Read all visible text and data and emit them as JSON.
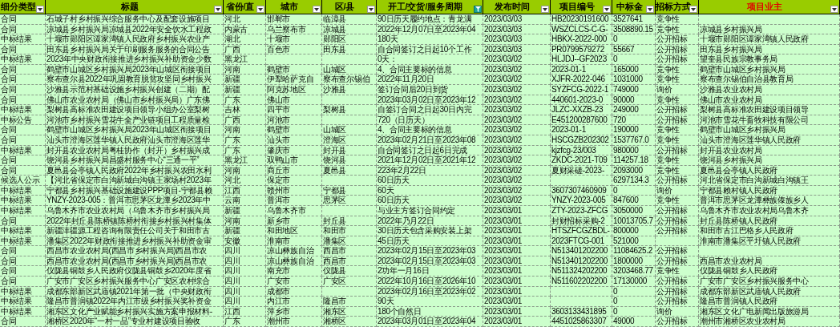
{
  "table": {
    "columns": [
      {
        "label": "细分类型",
        "filtered": false,
        "highlighted": false
      },
      {
        "label": "标题",
        "filtered": false,
        "highlighted": false
      },
      {
        "label": "省份/直",
        "filtered": false,
        "highlighted": false
      },
      {
        "label": "城市",
        "filtered": false,
        "highlighted": false
      },
      {
        "label": "区/县",
        "filtered": false,
        "highlighted": false
      },
      {
        "label": "开工/交货/服务周期",
        "filtered": true,
        "highlighted": false
      },
      {
        "label": "发布时间",
        "filtered": false,
        "highlighted": false
      },
      {
        "label": "项目编号",
        "filtered": false,
        "highlighted": false
      },
      {
        "label": "中标金",
        "filtered": false,
        "highlighted": false
      },
      {
        "label": "招标方式",
        "filtered": false,
        "highlighted": false
      },
      {
        "label": "项目业主",
        "filtered": false,
        "highlighted": true
      }
    ],
    "rows": [
      [
        "合同",
        "石城子村乡村振兴综合服务中心及配套设施项目",
        "河北",
        "邯郸市",
        "临漳县",
        "90日历天履约地点：青龙满",
        "2023/03/03",
        "HB20230191600",
        "3527641",
        "竞争性",
        null
      ],
      [
        "合同",
        "凉城县乡村振兴局凉城县2022年安全饮水工程政",
        "内蒙古",
        "乌兰察布市",
        "凉城县",
        "2022年12月07日至2023年04",
        "2023/03/03",
        "WSZCLCS-C-G-",
        "3508890.15",
        "竞争性",
        "凉城县乡村振兴局"
      ],
      [
        "中标结果",
        "十堰市郧阳区谭家湾镇人民政府乡村振兴农业产",
        "湖北",
        "十堰市",
        "郧阳区",
        "180天",
        "2023/03/03",
        "HBKX-2022-000",
        "0",
        "公开招标",
        "十堰市郧阳区谭家湾镇人民政府"
      ],
      [
        "合同",
        "田东县乡村振兴局关于印刷服务服务的合同公告",
        "广西",
        "百色市",
        "田东县",
        "自合同签订之日起10个工作",
        "2023/03/03",
        "PR0799579272",
        "55667",
        "公开招标",
        "田东县乡村振兴局"
      ],
      [
        "中标结果",
        "2023年中央财政衔接推进乡村振兴补助资金少数",
        "黑龙江",
        null,
        null,
        "0天：",
        "2023/03/02",
        "HLJDJ--GF2023",
        "0",
        "公开招标",
        "望奎县民族宗教事务局"
      ],
      [
        "合同",
        "鹤壁市山城区乡村振兴局2023年山城区衔接项目",
        "河南",
        "鹤壁市",
        "山城区",
        "4、合同主要标的信息",
        "2023/03/02",
        "2023-01-1",
        "165000",
        "竞争性",
        "鹤壁市山城区乡村振兴局"
      ],
      [
        "合同",
        "察布查尔县2022年巩固教育脱贫攻坚同乡村振兴",
        "新疆",
        "伊犁哈萨克自",
        "察布查尔锡伯",
        "2022年11月20日",
        "2023/03/02",
        "XJFR-2022-046",
        "1031000",
        "竞争性",
        "察布查尔锡伯自治县教育局"
      ],
      [
        "合同",
        "沙雅县示范村基础设施乡村振兴创建（二期）配",
        "新疆",
        "阿克苏地区",
        "沙雅县",
        "签订合同后20日到货",
        "2023/03/02",
        "SYZFCG-2022-1",
        "749000",
        "询价",
        "沙雅县农业农村局"
      ],
      [
        "合同",
        "佛山市农业农村局（佛山市乡村振兴局）广东佛",
        "广东",
        "佛山市",
        null,
        "2023年03月02日至2023年12",
        "2023/03/02",
        "440601-2023-0",
        "90000",
        "竞争性",
        "佛山市农业农村局"
      ],
      [
        "中标结果",
        "梨树县高标准农田建设项目领导小组办公室梨树",
        "吉林",
        "四平市",
        "梨树县",
        "自签订合同之日起30日内完",
        "2023/03/02",
        "JLZC-XXZB-23",
        "249000",
        "公开招标",
        "梨树县高标准农田建设项目领导"
      ],
      [
        "中标公告",
        "河池市乡村振兴雪花牛全产业链项目工程质量检",
        "广西",
        "河池市",
        null,
        "720（日历天）",
        "2023/03/02",
        "E451200287600",
        "720",
        "公开招标",
        "河池市雪花牛畜牧科技有限公司"
      ],
      [
        "合同",
        "鹤壁市山城区乡村振兴局2023年山城区衔接项目",
        "河南",
        "鹤壁市",
        "山城区",
        "4、合同主要标的信息",
        "2023/03/02",
        "2023-01-1",
        "190000",
        "竞争性",
        "鹤壁市山城区乡村振兴局"
      ],
      [
        "合同",
        "汕头市澄海区莲华镇人民政府汕头市澄海区莲华",
        "广东",
        "汕头市",
        "澄海区",
        "2023年02月21日至2023年08",
        "2023/03/02",
        "HSCGZB202302",
        "1537767.0",
        "竞争性",
        "汕头市澄海区莲华镇人民政府"
      ],
      [
        "中标结果",
        "封开县农业农村局粤桂协作（封开）乡村振兴成",
        "广东",
        "肇庆市",
        "封开县",
        "自合同签订之日起6日完成",
        "2023/03/02",
        "kjzfcg-23/003",
        "980000",
        "公开招标",
        "封开县农业农村局"
      ],
      [
        "合同",
        "饶河县乡村振兴局昌盛村服务中心“三通一平”",
        "黑龙江",
        "双鸭山市",
        "饶河县",
        "2021年12月02日至2021年12",
        "2023/03/02",
        "ZKDC-2021-T09",
        "114257.18",
        "竞争性",
        "饶河县乡村振兴局"
      ],
      [
        "合同",
        "夏邑县会亭镇人民政府2022年乡村振兴农田水利",
        "河南",
        "商丘市",
        "夏邑县",
        "223年2月22日",
        "2023/03/02",
        "夏财采磋-2023-",
        "2093000",
        "竞争性",
        "夏邑县会亭镇人民政府"
      ],
      [
        "候选人公示",
        "【河北省保定市白沟新城白沟镇王家场村2023年",
        "河北",
        "保定市",
        null,
        "60日历天",
        "2023/03/02",
        null,
        "6297134.3",
        "公开招标",
        "河北省保定市白沟新城白沟镇王"
      ],
      [
        "中标结果",
        "宁都县乡村振兴基础设施建设PPP项目-宁都县赖",
        "江西",
        "赣州市",
        "宁都县",
        "60天",
        "2023/03/02",
        "3607307460909",
        "0",
        "询价",
        "宁都县赖村镇人民政府"
      ],
      [
        "中标结果",
        "YNZY-2023-005：普洱市思茅区龙潭乡2023年中",
        "云南",
        "普洱市",
        "思茅区",
        "60日历天",
        "2023/03/02",
        "YNZY-2023-005",
        "847600",
        "竞争性",
        "普洱市思茅区龙潭彝族傣族乡人"
      ],
      [
        "中标结果",
        "乌鲁木齐市农业农村局（乌鲁木齐市乡村振兴局",
        "新疆",
        "乌鲁木齐市",
        null,
        "与业主方签订合同约定",
        "2023/03/01",
        "ZTY-2023-ZFCG",
        "3050000",
        "公开招标",
        "乌鲁木齐市农业农村局乌鲁木齐"
      ],
      [
        "合同",
        "2022年封丘县陈桥镇陈桥村衔接乡村振兴村集体",
        "河南",
        "新乡市",
        "封丘县",
        "2022年乃月22日",
        "2023/03/01",
        "封财招标采购-2",
        "10013705.7",
        "公开招标",
        "封丘县陈桥镇人民政府"
      ],
      [
        "中标结果",
        "新疆沣疆源工程咨询有限责任公司关于和田市古",
        "新疆",
        "和田地区",
        "和田市",
        "30日历天包含采购安装上架",
        "2023/03/01",
        "HTSZFCGZBDL-",
        "800000",
        "公开招标",
        "和田市古江巴格乡人民政府"
      ],
      [
        "中标结果",
        "潘集区2022年财政衔接推进乡村振兴补助资金审",
        "安徽",
        "淮南市",
        "潘集区",
        "45日历天",
        "2023/03/01",
        "2023FTCG-001",
        "521000",
        null,
        "淮南市潘集区平圩镇人民政府"
      ],
      [
        "合同",
        "西昌市农业农村局(西昌市乡村振兴局)西昌市农",
        "四川",
        "凉山彝族自治",
        "西昌市",
        "2023年02月15日至2023年03",
        "2023/03/01",
        "N513401202200",
        "11084625.2",
        "公开招标",
        null
      ],
      [
        "合同",
        "西昌市农业农村局(西昌市乡村振兴局)西昌市农",
        "四川",
        "凉山彝族自治",
        "西昌市",
        "2023年02月15日至2023年03",
        "2023/03/01",
        "N513401202200",
        "1800000",
        "公开招标",
        "西昌市农业农村局"
      ],
      [
        "合同",
        "仪陇县铜鼓乡人民政府仪陇县铜鼓乡2020年度省",
        "四川",
        "南充市",
        "仪陇县",
        "2功年一月16日",
        "2023/03/01",
        "N511324202200",
        "3203468.77",
        "竞争性",
        "仪陇县铜鼓乡人民政府"
      ],
      [
        "合同",
        "广安市广安区乡村振兴服务中心广安区农村综合",
        "四川",
        "广安市",
        "广安区",
        "2022年10月16日至2026年10",
        "2023/03/01",
        "N511602202200",
        "17130000",
        "公开招标",
        "广安市广安区乡村振兴服务中心"
      ],
      [
        "中标结果",
        "成都东部新区武庙镇2021年第一批（中央财政衔",
        "四川",
        "成都市",
        null,
        "2023年02月16日至2023年02",
        "2023/03/01",
        null,
        "0",
        "公开招标",
        "成都东部新区武庙镇人民政府"
      ],
      [
        "中标结果",
        "隆昌市普润镇2022年内江市级乡村振兴奖补资金",
        "四川",
        "内江市",
        "隆昌市",
        "90天",
        "2023/03/01",
        null,
        "0",
        "公开招标",
        "隆昌市普润镇人民政府"
      ],
      [
        "中标结果",
        "湘东区文化产业赋能乡村振兴实施方案申报材料-",
        "江西",
        "萍乡市",
        "湘东区",
        "180个自然日",
        "2023/03/01",
        "3603133431895",
        "0",
        "询价",
        "湘东区文化广电新闻出版旅游局"
      ],
      [
        "合同",
        "湘桥区2020年“一村一品”专业村建设项目验收",
        "广东",
        "潮州市",
        "湘桥区",
        "2023年03月01日至2023年04",
        "2023/03/01",
        "4451025863307",
        "49000",
        "公开招标",
        "潮州市湘桥区农业农村局"
      ]
    ]
  }
}
